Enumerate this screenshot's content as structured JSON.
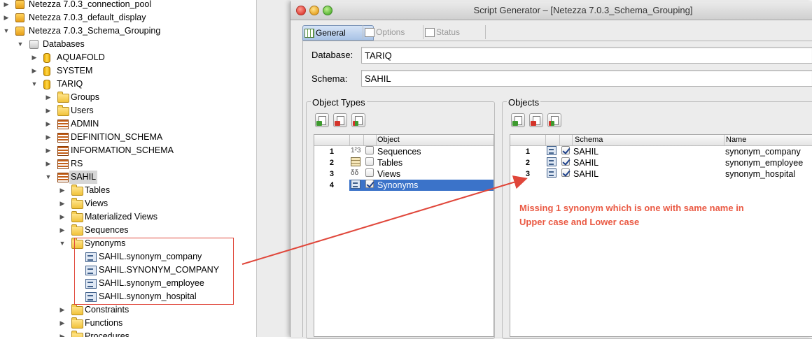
{
  "tree": {
    "items": [
      {
        "label": "Netezza 7.0.3_connection_pool",
        "icon": "connection-icon",
        "level": 0,
        "toggle": "collapsed"
      },
      {
        "label": "Netezza 7.0.3_default_display",
        "icon": "connection-icon",
        "level": 0,
        "toggle": "collapsed"
      },
      {
        "label": "Netezza 7.0.3_Schema_Grouping",
        "icon": "connection-icon",
        "level": 0,
        "toggle": "expanded"
      },
      {
        "label": "Databases",
        "icon": "databases-icon",
        "level": 1,
        "toggle": "expanded"
      },
      {
        "label": "AQUAFOLD",
        "icon": "database-icon",
        "level": 2,
        "toggle": "collapsed"
      },
      {
        "label": "SYSTEM",
        "icon": "database-icon",
        "level": 2,
        "toggle": "collapsed"
      },
      {
        "label": "TARIQ",
        "icon": "database-icon",
        "level": 2,
        "toggle": "expanded"
      },
      {
        "label": "Groups",
        "icon": "folder-icon",
        "level": 3,
        "toggle": "collapsed"
      },
      {
        "label": "Users",
        "icon": "folder-icon",
        "level": 3,
        "toggle": "collapsed"
      },
      {
        "label": "ADMIN",
        "icon": "schema-icon",
        "level": 3,
        "toggle": "collapsed"
      },
      {
        "label": "DEFINITION_SCHEMA",
        "icon": "schema-icon",
        "level": 3,
        "toggle": "collapsed"
      },
      {
        "label": "INFORMATION_SCHEMA",
        "icon": "schema-icon",
        "level": 3,
        "toggle": "collapsed"
      },
      {
        "label": "RS",
        "icon": "schema-icon",
        "level": 3,
        "toggle": "collapsed"
      },
      {
        "label": "SAHIL",
        "icon": "schema-icon",
        "level": 3,
        "toggle": "expanded",
        "selected": true
      },
      {
        "label": "Tables",
        "icon": "folder-icon",
        "level": 4,
        "toggle": "collapsed"
      },
      {
        "label": "Views",
        "icon": "folder-icon",
        "level": 4,
        "toggle": "collapsed"
      },
      {
        "label": "Materialized Views",
        "icon": "folder-icon",
        "level": 4,
        "toggle": "collapsed"
      },
      {
        "label": "Sequences",
        "icon": "folder-icon",
        "level": 4,
        "toggle": "collapsed"
      },
      {
        "label": "Synonyms",
        "icon": "folder-open-icon",
        "level": 4,
        "toggle": "expanded"
      },
      {
        "label": "SAHIL.synonym_company",
        "icon": "synonym-icon",
        "level": 5,
        "toggle": "none"
      },
      {
        "label": "SAHIL.SYNONYM_COMPANY",
        "icon": "synonym-icon",
        "level": 5,
        "toggle": "none"
      },
      {
        "label": "SAHIL.synonym_employee",
        "icon": "synonym-icon",
        "level": 5,
        "toggle": "none"
      },
      {
        "label": "SAHIL.synonym_hospital",
        "icon": "synonym-icon",
        "level": 5,
        "toggle": "none"
      },
      {
        "label": "Constraints",
        "icon": "folder-icon",
        "level": 4,
        "toggle": "collapsed"
      },
      {
        "label": "Functions",
        "icon": "folder-icon",
        "level": 4,
        "toggle": "collapsed"
      },
      {
        "label": "Procedures",
        "icon": "folder-icon",
        "level": 4,
        "toggle": "collapsed"
      }
    ]
  },
  "dialog": {
    "title": "Script Generator – [Netezza 7.0.3_Schema_Grouping]",
    "tabs": [
      {
        "label": "General",
        "active": true
      },
      {
        "label": "Options",
        "active": false
      },
      {
        "label": "Status",
        "active": false
      }
    ],
    "database_label": "Database:",
    "database_value": "TARIQ",
    "schema_label": "Schema:",
    "schema_value": "SAHIL",
    "object_types": {
      "title": "Object Types",
      "column_header": "Object",
      "rows": [
        {
          "num": "1",
          "icon": "sequence-icon",
          "checked": false,
          "label": "Sequences",
          "selected": false
        },
        {
          "num": "2",
          "icon": "table-icon",
          "checked": false,
          "label": "Tables",
          "selected": false
        },
        {
          "num": "3",
          "icon": "view-icon",
          "checked": false,
          "label": "Views",
          "selected": false
        },
        {
          "num": "4",
          "icon": "synonym-icon",
          "checked": true,
          "label": "Synonyms",
          "selected": true
        }
      ]
    },
    "objects": {
      "title": "Objects",
      "columns": [
        "Schema",
        "Name"
      ],
      "rows": [
        {
          "num": "1",
          "checked": true,
          "schema": "SAHIL",
          "name": "synonym_company"
        },
        {
          "num": "2",
          "checked": true,
          "schema": "SAHIL",
          "name": "synonym_employee"
        },
        {
          "num": "3",
          "checked": true,
          "schema": "SAHIL",
          "name": "synonym_hospital"
        }
      ]
    }
  },
  "annotation": {
    "lines": [
      "Missing 1 synonym which is one with same name in",
      "Upper case and Lower case"
    ],
    "color": "#ea5a44"
  }
}
